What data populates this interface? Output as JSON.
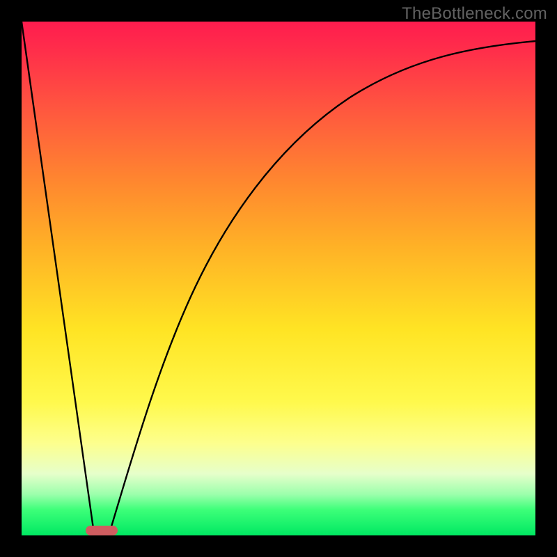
{
  "watermark": "TheBottleneck.com",
  "chart_data": {
    "type": "line",
    "title": "",
    "xlabel": "",
    "ylabel": "",
    "xlim": [
      0,
      100
    ],
    "ylim": [
      0,
      100
    ],
    "grid": false,
    "legend": false,
    "background_gradient": {
      "orientation": "vertical",
      "stops": [
        {
          "pos": 0,
          "color": "#ff1c4e"
        },
        {
          "pos": 18,
          "color": "#ff5a3e"
        },
        {
          "pos": 44,
          "color": "#ffb226"
        },
        {
          "pos": 74,
          "color": "#fff94c"
        },
        {
          "pos": 88,
          "color": "#e6ffca"
        },
        {
          "pos": 100,
          "color": "#00e862"
        }
      ]
    },
    "series": [
      {
        "name": "left-limb",
        "x": [
          0,
          14
        ],
        "y": [
          100,
          0
        ],
        "style": "line",
        "color": "#000000"
      },
      {
        "name": "right-limb",
        "x": [
          17,
          20,
          24,
          28,
          33,
          39,
          46,
          55,
          66,
          80,
          100
        ],
        "y": [
          0,
          12,
          26,
          38,
          50,
          61,
          71,
          80,
          87,
          92,
          96
        ],
        "style": "curve",
        "color": "#000000"
      }
    ],
    "annotations": {
      "optimal_marker": {
        "x": 15.5,
        "y": 1,
        "color": "#cf5d60",
        "shape": "pill"
      }
    }
  }
}
